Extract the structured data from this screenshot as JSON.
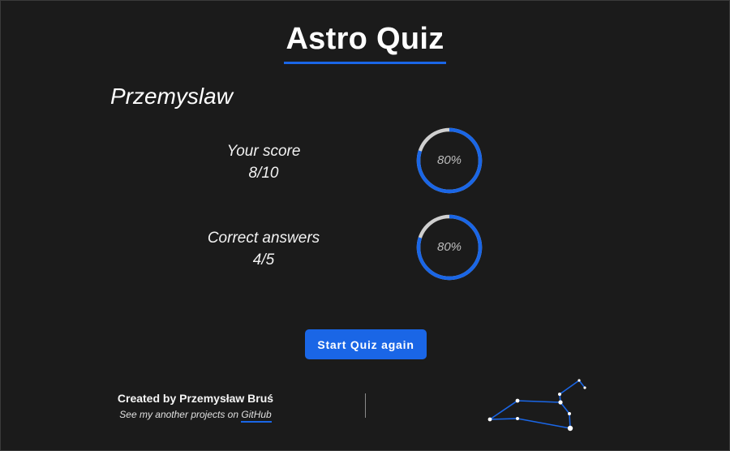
{
  "app": {
    "title": "Astro Quiz"
  },
  "user": {
    "name": "Przemyslaw"
  },
  "results": {
    "score": {
      "label": "Your score",
      "value": "8/10",
      "percent_label": "80%",
      "fraction": 0.8
    },
    "correct": {
      "label": "Correct answers",
      "value": "4/5",
      "percent_label": "80%",
      "fraction": 0.8
    }
  },
  "actions": {
    "restart_label": "Start Quiz again"
  },
  "footer": {
    "credit": "Created by Przemysław Bruś",
    "more_text": "See my another projects on",
    "github_link": "GitHub"
  },
  "colors": {
    "accent": "#1a66e6",
    "background": "#1b1b1b",
    "ring_track": "#cfcfcf"
  },
  "icons": {
    "constellation": "constellation-icon"
  }
}
